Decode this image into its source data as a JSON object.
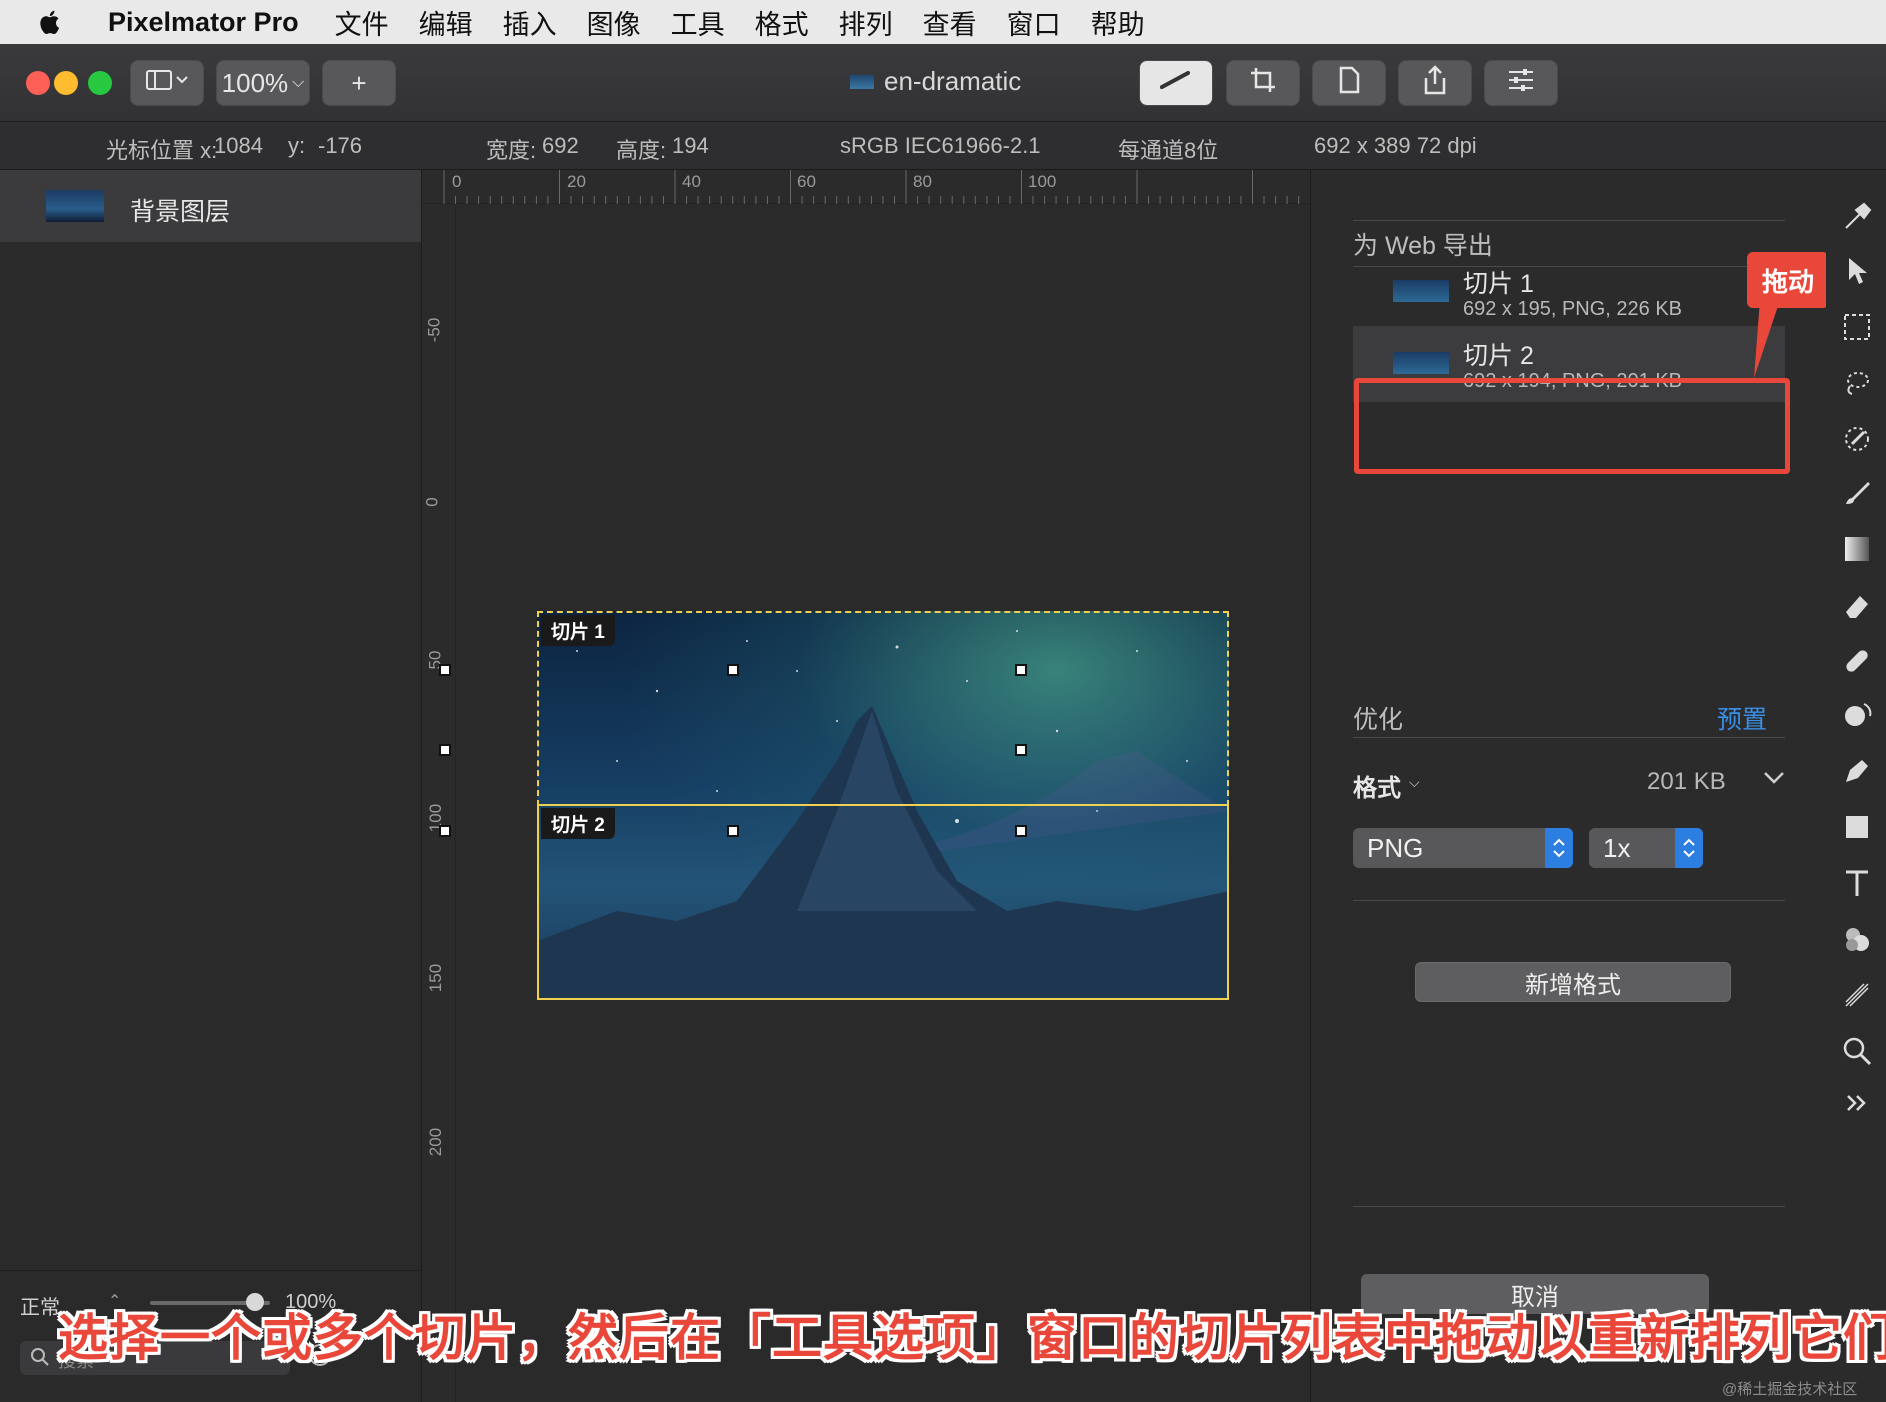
{
  "menubar": {
    "app_name": "Pixelmator Pro",
    "items": [
      "文件",
      "编辑",
      "插入",
      "图像",
      "工具",
      "格式",
      "排列",
      "查看",
      "窗口",
      "帮助"
    ]
  },
  "toolbar": {
    "zoom": "100%",
    "add_label": "+",
    "document_title": "en-dramatic"
  },
  "infobar": {
    "cursor_label": "光标位置 x:",
    "cursor_x": "1084",
    "cursor_y_label": "y:",
    "cursor_y": "-176",
    "width_label": "宽度:",
    "width": "692",
    "height_label": "高度:",
    "height": "194",
    "color_profile": "sRGB IEC61966-2.1",
    "bit_depth": "每通道8位",
    "dimensions": "692 x 389 72 dpi"
  },
  "layers": {
    "items": [
      {
        "name": "背景图层"
      }
    ],
    "blend_mode": "正常",
    "opacity": "100%",
    "search_placeholder": "搜索"
  },
  "rulers": {
    "top_ticks": [
      "0",
      "20",
      "40",
      "60",
      "80",
      "100"
    ],
    "left_ticks": [
      "-50",
      "0",
      "50",
      "100",
      "150",
      "200"
    ]
  },
  "canvas": {
    "slices": [
      {
        "tag": "切片 1"
      },
      {
        "tag": "切片 2"
      }
    ]
  },
  "options": {
    "web_export_title": "为 Web 导出",
    "slices": [
      {
        "name": "切片 1",
        "meta": "692 x 195, PNG, 226 KB"
      },
      {
        "name": "切片 2",
        "meta": "692 x 194, PNG, 201 KB"
      }
    ],
    "drag_callout": "拖动",
    "optimize_title": "优化",
    "preset_label": "预置",
    "format_label": "格式",
    "format_size": "201 KB",
    "format_value": "PNG",
    "scale_value": "1x",
    "add_format_label": "新增格式",
    "cancel_label": "取消"
  },
  "caption": "选择一个或多个切片，然后在「工具选项」窗口的切片列表中拖动以重新排列它们",
  "watermark": "@稀土掘金技术社区",
  "colors": {
    "accent": "#3a8ee6",
    "annotation": "#e9473a",
    "slice_border": "#f0d050"
  }
}
